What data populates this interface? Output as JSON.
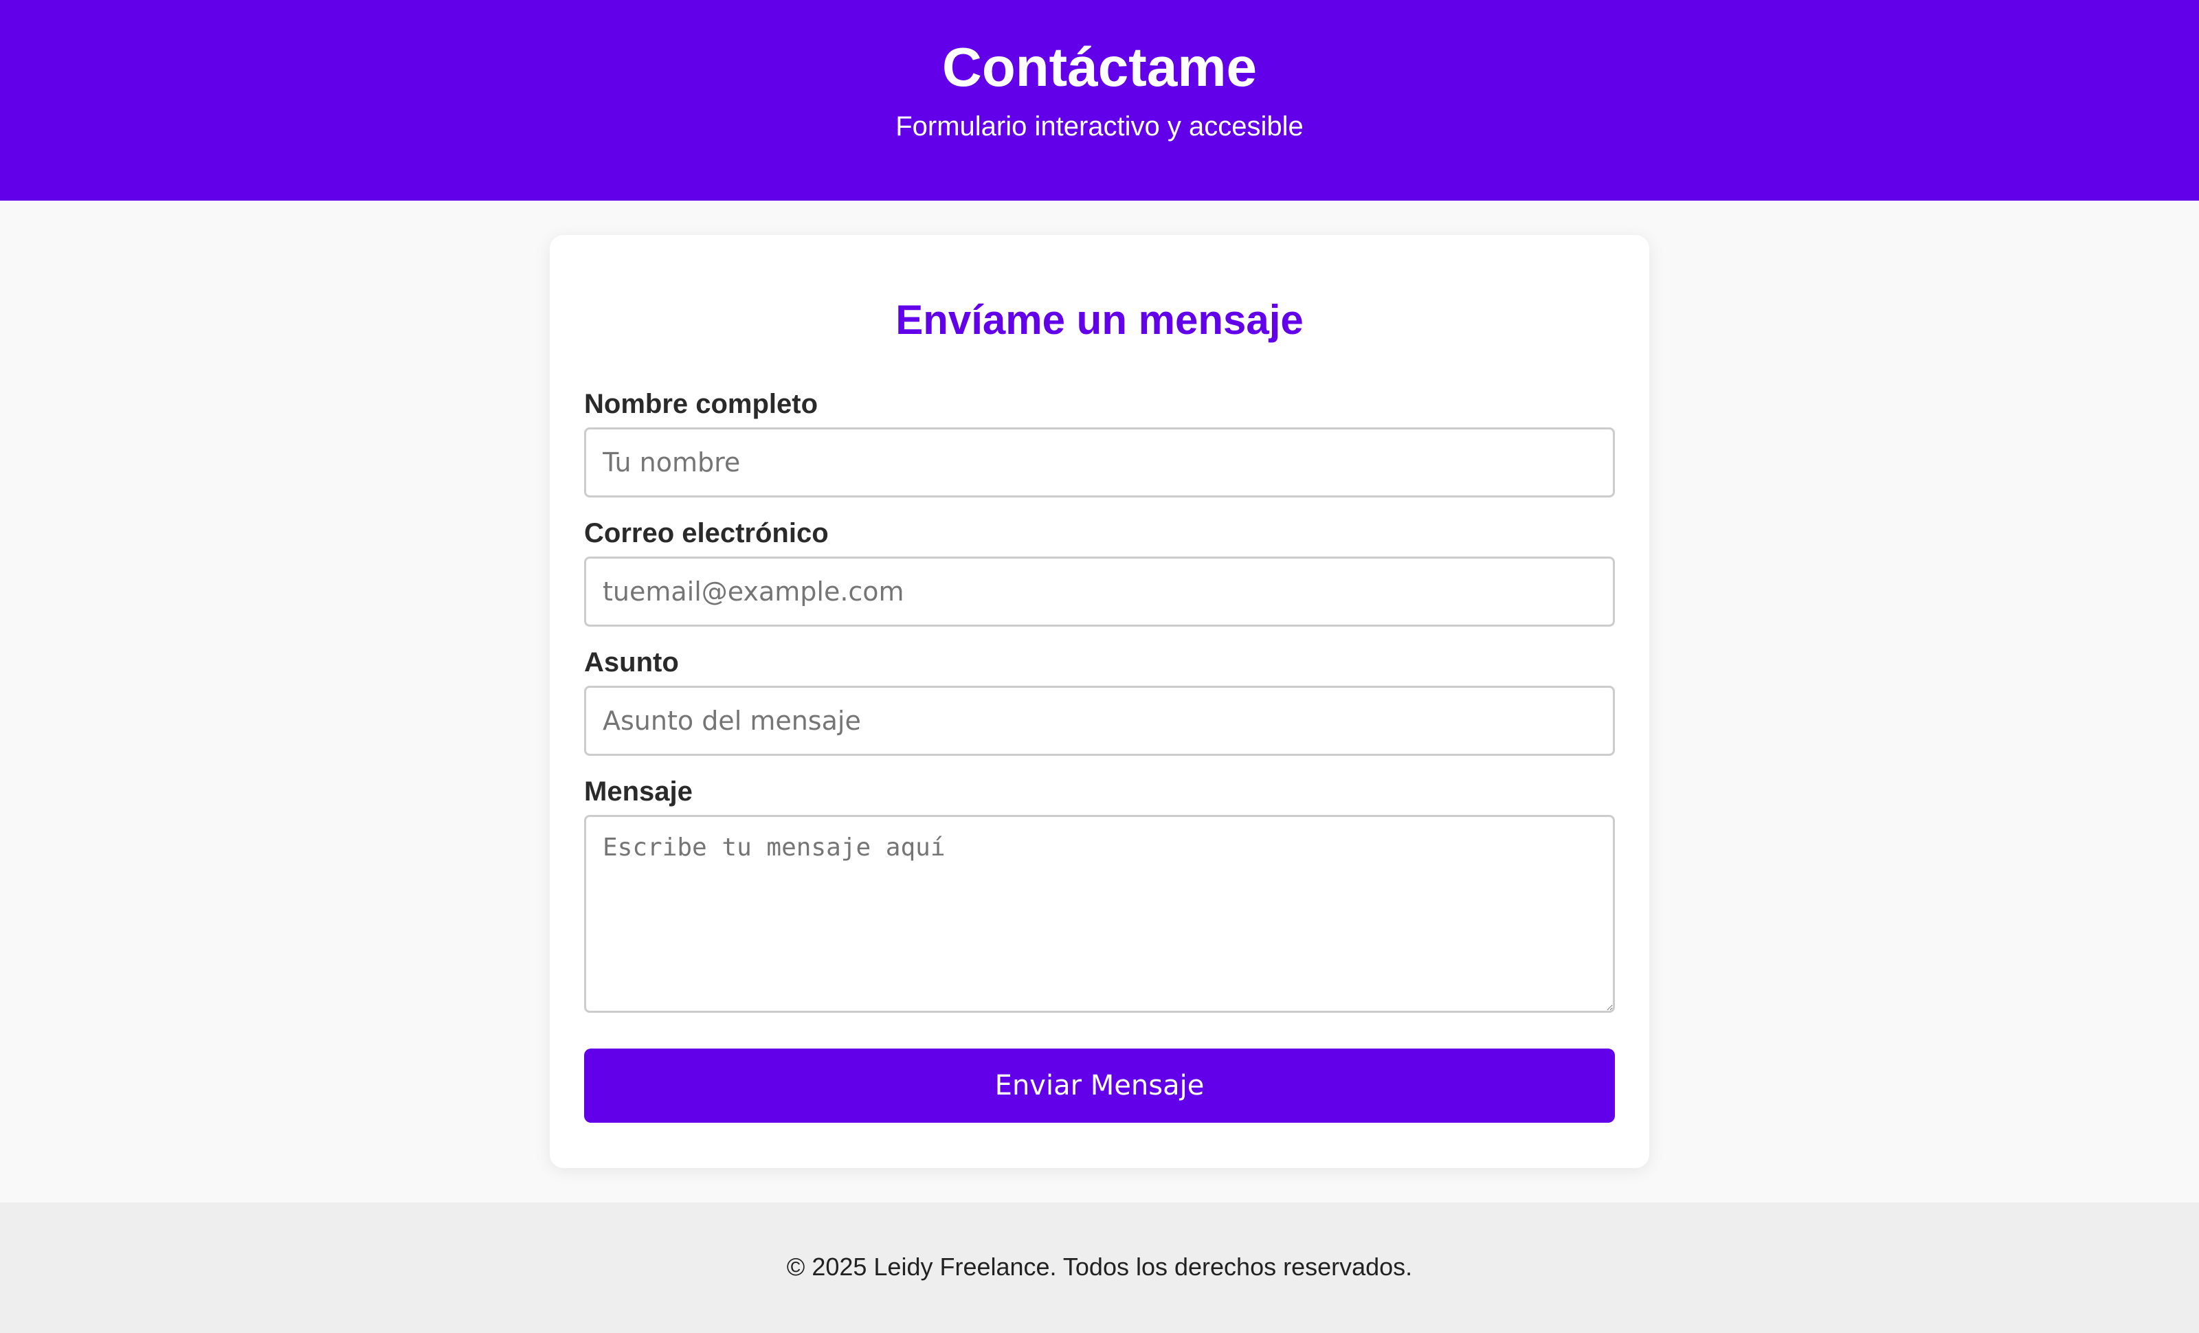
{
  "header": {
    "title": "Contáctame",
    "subtitle": "Formulario interactivo y accesible"
  },
  "form": {
    "title": "Envíame un mensaje",
    "fields": {
      "name": {
        "label": "Nombre completo",
        "placeholder": "Tu nombre",
        "value": ""
      },
      "email": {
        "label": "Correo electrónico",
        "placeholder": "tuemail@example.com",
        "value": ""
      },
      "subject": {
        "label": "Asunto",
        "placeholder": "Asunto del mensaje",
        "value": ""
      },
      "message": {
        "label": "Mensaje",
        "placeholder": "Escribe tu mensaje aquí",
        "value": ""
      }
    },
    "submit_label": "Enviar Mensaje"
  },
  "footer": {
    "text": "© 2025 Leidy Freelance. Todos los derechos reservados."
  },
  "colors": {
    "accent": "#6200ea",
    "page_background": "#f9f9f9",
    "footer_background": "#eeeeee"
  }
}
